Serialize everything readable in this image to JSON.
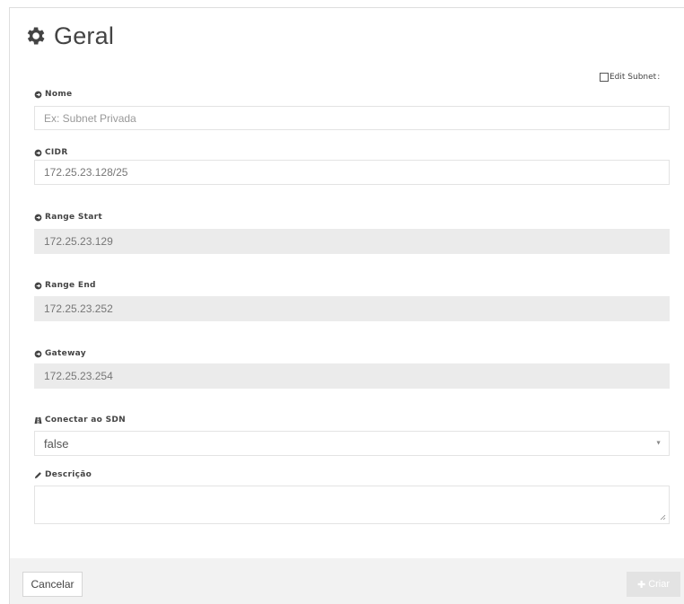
{
  "header": {
    "title": "Geral",
    "icon": "gear-icon"
  },
  "edit_subnet": {
    "label": "Edit Subnet",
    "checked": false
  },
  "fields": {
    "nome": {
      "label": "Nome",
      "value": "",
      "placeholder": "Ex: Subnet Privada"
    },
    "cidr": {
      "label": "CIDR",
      "value": "172.25.23.128/25"
    },
    "range_start": {
      "label": "Range Start",
      "value": "172.25.23.129"
    },
    "range_end": {
      "label": "Range End",
      "value": "172.25.23.252"
    },
    "gateway": {
      "label": "Gateway",
      "value": "172.25.23.254"
    },
    "conectar_sdn": {
      "label": "Conectar ao SDN",
      "value": "false",
      "icon": "road-icon"
    },
    "descricao": {
      "label": "Descrição",
      "value": "",
      "icon": "pencil-icon"
    }
  },
  "buttons": {
    "cancel": "Cancelar",
    "create": "Criar",
    "create_icon": "plus-icon"
  },
  "colors": {
    "readonly_bg": "#ebebeb",
    "footer_bg": "#f2f2f2",
    "disabled_button": "#e3e3e3"
  }
}
